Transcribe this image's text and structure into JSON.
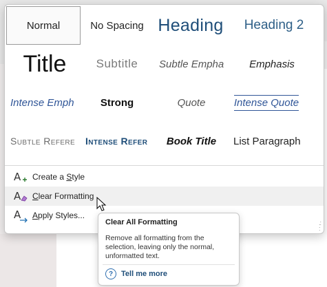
{
  "styles_gallery": {
    "styles": [
      {
        "label": "Normal"
      },
      {
        "label": "No Spacing"
      },
      {
        "label": "Heading"
      },
      {
        "label": "Heading 2"
      },
      {
        "label": "Title"
      },
      {
        "label": "Subtitle"
      },
      {
        "label": "Subtle Empha"
      },
      {
        "label": "Emphasis"
      },
      {
        "label": "Intense Emph"
      },
      {
        "label": "Strong"
      },
      {
        "label": "Quote"
      },
      {
        "label": "Intense Quote"
      },
      {
        "label": "Subtle Refere"
      },
      {
        "label": "Intense Refer"
      },
      {
        "label": "Book Title"
      },
      {
        "label": "List Paragraph"
      }
    ],
    "selected_style": "Normal"
  },
  "menu": {
    "items": [
      {
        "label": "Create a Style",
        "icon": "create-style-icon"
      },
      {
        "label": "Clear Formatting",
        "icon": "clear-formatting-icon"
      },
      {
        "label": "Apply Styles...",
        "icon": "apply-styles-icon"
      }
    ]
  },
  "tooltip": {
    "title": "Clear All Formatting",
    "body": "Remove all formatting from the selection, leaving only the normal, unformatted text.",
    "link": "Tell me more",
    "link_icon": "help-icon"
  },
  "colors": {
    "heading_blue": "#1f4e79",
    "intense_blue": "#2f5597",
    "hover_bg": "#f0f0f0",
    "eraser_purple": "#7b3fa0"
  }
}
